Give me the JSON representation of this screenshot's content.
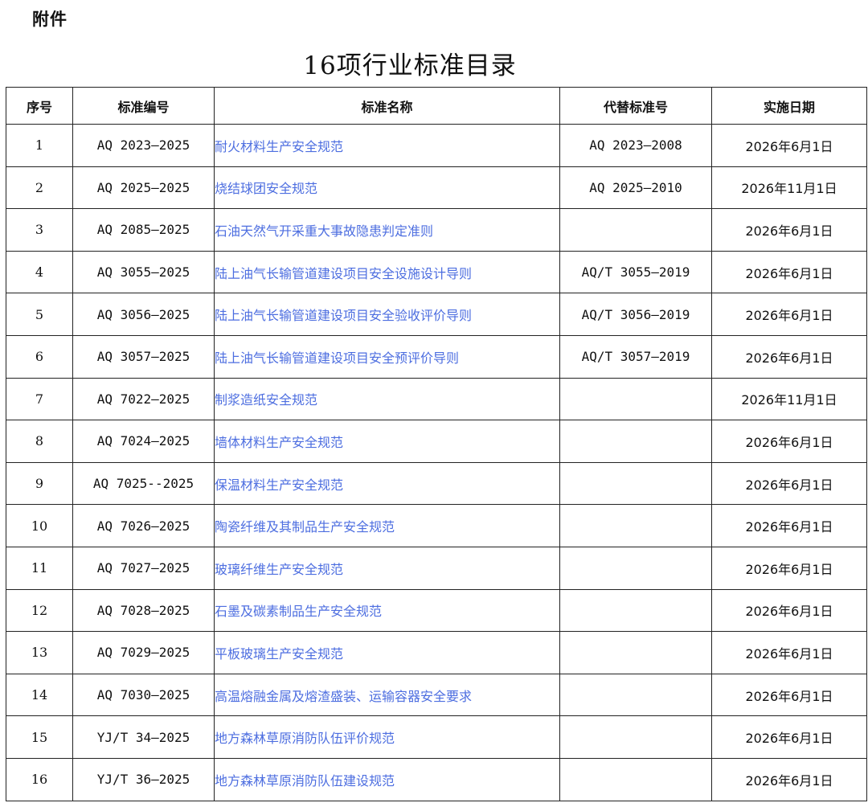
{
  "attachment_label": "附件",
  "title": "16项行业标准目录",
  "table": {
    "headers": {
      "no": "序号",
      "code": "标准编号",
      "name": "标准名称",
      "replaces": "代替标准号",
      "date": "实施日期"
    },
    "rows": [
      {
        "no": "1",
        "code": "AQ 2023—2025",
        "name": "耐火材料生产安全规范",
        "replaces": "AQ 2023—2008",
        "date": "2026年6月1日"
      },
      {
        "no": "2",
        "code": "AQ 2025—2025",
        "name": "烧结球团安全规范",
        "replaces": "AQ 2025—2010",
        "date": "2026年11月1日"
      },
      {
        "no": "3",
        "code": "AQ 2085—2025",
        "name": "石油天然气开采重大事故隐患判定准则",
        "replaces": "",
        "date": "2026年6月1日"
      },
      {
        "no": "4",
        "code": "AQ 3055—2025",
        "name": "陆上油气长输管道建设项目安全设施设计导则",
        "replaces": "AQ/T 3055—2019",
        "date": "2026年6月1日"
      },
      {
        "no": "5",
        "code": "AQ 3056—2025",
        "name": "陆上油气长输管道建设项目安全验收评价导则",
        "replaces": "AQ/T 3056—2019",
        "date": "2026年6月1日"
      },
      {
        "no": "6",
        "code": "AQ 3057—2025",
        "name": "陆上油气长输管道建设项目安全预评价导则",
        "replaces": "AQ/T 3057—2019",
        "date": "2026年6月1日"
      },
      {
        "no": "7",
        "code": "AQ 7022—2025",
        "name": "制浆造纸安全规范",
        "replaces": "",
        "date": "2026年11月1日"
      },
      {
        "no": "8",
        "code": "AQ 7024—2025",
        "name": "墙体材料生产安全规范",
        "replaces": "",
        "date": "2026年6月1日"
      },
      {
        "no": "9",
        "code": "AQ 7025--2025",
        "name": "保温材料生产安全规范",
        "replaces": "",
        "date": "2026年6月1日"
      },
      {
        "no": "10",
        "code": "AQ 7026—2025",
        "name": "陶瓷纤维及其制品生产安全规范",
        "replaces": "",
        "date": "2026年6月1日"
      },
      {
        "no": "11",
        "code": "AQ 7027—2025",
        "name": "玻璃纤维生产安全规范",
        "replaces": "",
        "date": "2026年6月1日"
      },
      {
        "no": "12",
        "code": "AQ 7028—2025",
        "name": "石墨及碳素制品生产安全规范",
        "replaces": "",
        "date": "2026年6月1日"
      },
      {
        "no": "13",
        "code": "AQ 7029—2025",
        "name": "平板玻璃生产安全规范",
        "replaces": "",
        "date": "2026年6月1日"
      },
      {
        "no": "14",
        "code": "AQ 7030—2025",
        "name": "高温熔融金属及熔渣盛装、运输容器安全要求",
        "replaces": "",
        "date": "2026年6月1日"
      },
      {
        "no": "15",
        "code": "YJ/T 34—2025",
        "name": "地方森林草原消防队伍评价规范",
        "replaces": "",
        "date": "2026年6月1日"
      },
      {
        "no": "16",
        "code": "YJ/T 36—2025",
        "name": "地方森林草原消防队伍建设规范",
        "replaces": "",
        "date": "2026年6月1日"
      }
    ]
  },
  "colors": {
    "link": "#4d6ee0",
    "text": "#111111",
    "border": "#222222"
  }
}
